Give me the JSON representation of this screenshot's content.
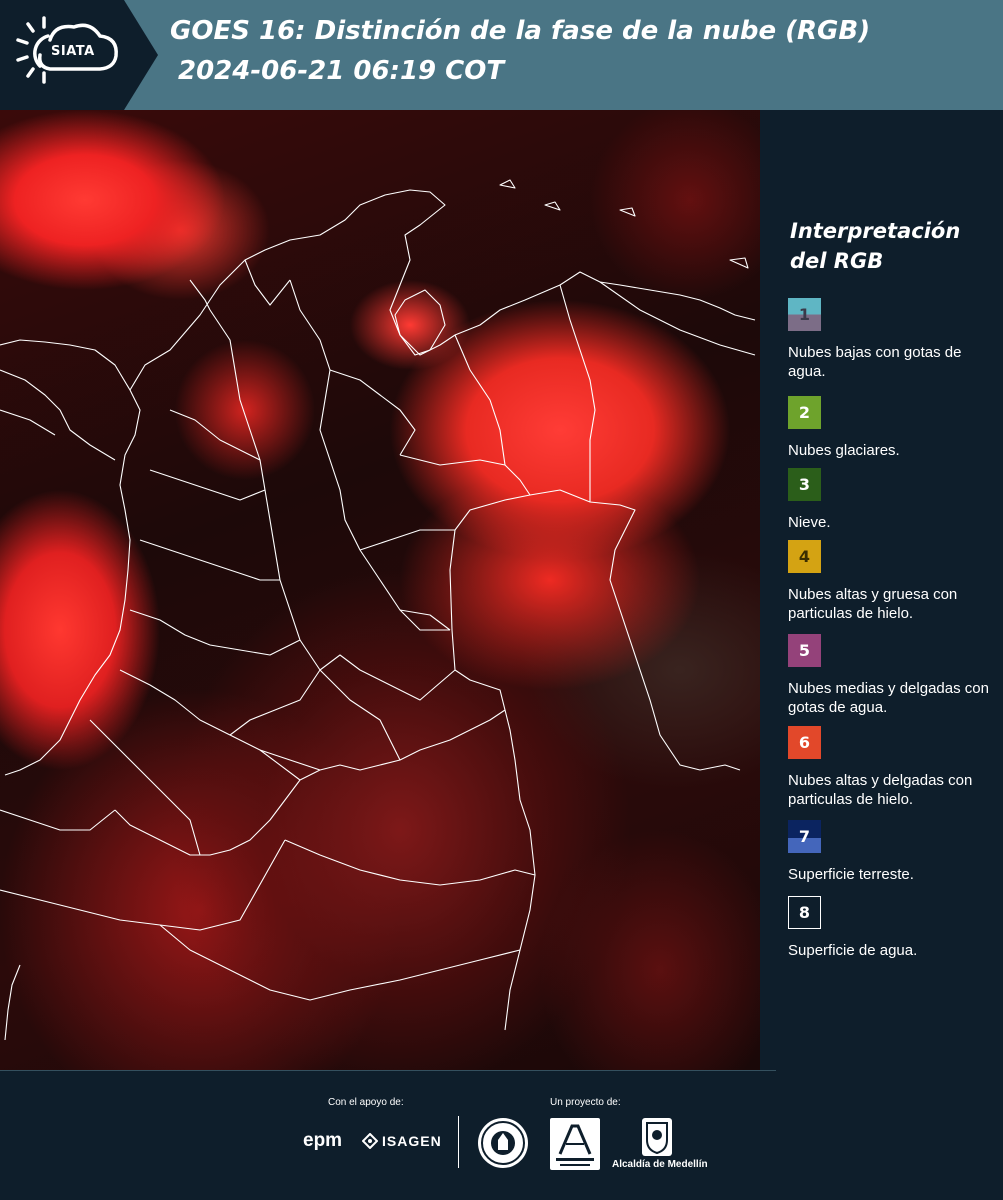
{
  "header": {
    "logo_text": "SIATA",
    "title_line1": "GOES 16: Distinción de la fase de la nube (RGB)",
    "title_line2": "2024-06-21 06:19 COT"
  },
  "legend": {
    "title": "Interpretación del RGB",
    "items": [
      {
        "number": "1",
        "label": "Nubes bajas con gotas de agua.",
        "colors": [
          "#5fb6c4",
          "#7c6d87"
        ]
      },
      {
        "number": "2",
        "label": "Nubes glaciares.",
        "colors": [
          "#6ea32c"
        ]
      },
      {
        "number": "3",
        "label": "Nieve.",
        "colors": [
          "#2b5e1a"
        ]
      },
      {
        "number": "4",
        "label": "Nubes altas y gruesa con particulas de hielo.",
        "colors": [
          "#d4a313"
        ]
      },
      {
        "number": "5",
        "label": "Nubes medias y delgadas con gotas de agua.",
        "colors": [
          "#94427a"
        ]
      },
      {
        "number": "6",
        "label": "Nubes altas y delgadas con particulas de hielo.",
        "colors": [
          "#e2482a"
        ]
      },
      {
        "number": "7",
        "label": "Superficie terreste.",
        "colors": [
          "#0b2460",
          "#4466bb"
        ]
      },
      {
        "number": "8",
        "label": "Superficie de agua.",
        "colors": [
          "#0e1e2b"
        ]
      }
    ]
  },
  "footer": {
    "support_label": "Con el apoyo de:",
    "project_label": "Un proyecto de:",
    "sponsors": [
      "epm",
      "ISAGEN"
    ],
    "partners": [
      "Área Metropolitana Valle de Aburrá",
      "Alcaldía de Medellín"
    ],
    "alcaldia_text": "Alcaldía de Medellín"
  },
  "colors": {
    "background": "#0e1e2b",
    "header_band": "#4a7585",
    "cloud_red": "#ff3a33"
  }
}
